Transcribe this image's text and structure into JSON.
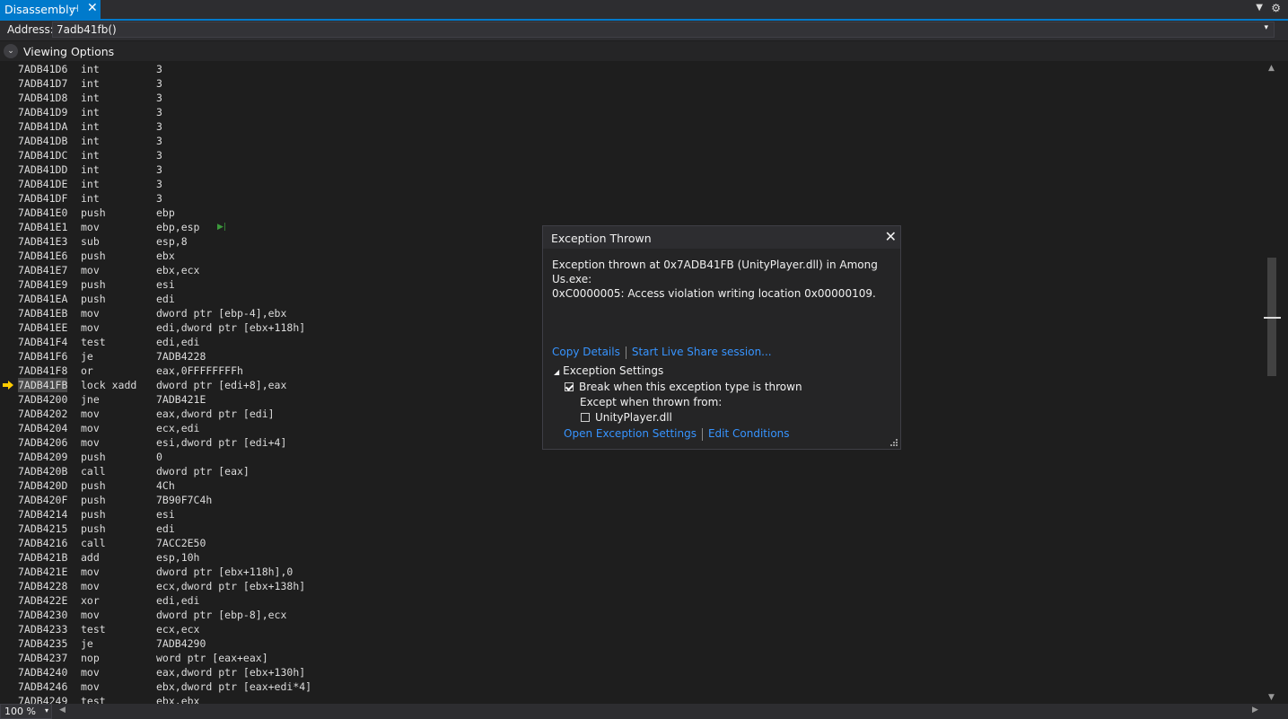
{
  "tab": {
    "title": "Disassembly",
    "pin": "⊣",
    "close": "✕"
  },
  "tabbar": {
    "menu": "▼",
    "gear": "⚙"
  },
  "address": {
    "label": "Address:",
    "value": "7adb41fb()",
    "drop": "▾"
  },
  "viewing_options": {
    "label": "Viewing Options",
    "toggle": "⌄"
  },
  "disassembly": [
    {
      "addr": "7ADB41D6",
      "mn": "int",
      "op": "3"
    },
    {
      "addr": "7ADB41D7",
      "mn": "int",
      "op": "3"
    },
    {
      "addr": "7ADB41D8",
      "mn": "int",
      "op": "3"
    },
    {
      "addr": "7ADB41D9",
      "mn": "int",
      "op": "3"
    },
    {
      "addr": "7ADB41DA",
      "mn": "int",
      "op": "3"
    },
    {
      "addr": "7ADB41DB",
      "mn": "int",
      "op": "3"
    },
    {
      "addr": "7ADB41DC",
      "mn": "int",
      "op": "3"
    },
    {
      "addr": "7ADB41DD",
      "mn": "int",
      "op": "3"
    },
    {
      "addr": "7ADB41DE",
      "mn": "int",
      "op": "3"
    },
    {
      "addr": "7ADB41DF",
      "mn": "int",
      "op": "3"
    },
    {
      "addr": "7ADB41E0",
      "mn": "push",
      "op": "ebp"
    },
    {
      "addr": "7ADB41E1",
      "mn": "mov",
      "op": "ebp,esp"
    },
    {
      "addr": "7ADB41E3",
      "mn": "sub",
      "op": "esp,8"
    },
    {
      "addr": "7ADB41E6",
      "mn": "push",
      "op": "ebx"
    },
    {
      "addr": "7ADB41E7",
      "mn": "mov",
      "op": "ebx,ecx"
    },
    {
      "addr": "7ADB41E9",
      "mn": "push",
      "op": "esi"
    },
    {
      "addr": "7ADB41EA",
      "mn": "push",
      "op": "edi"
    },
    {
      "addr": "7ADB41EB",
      "mn": "mov",
      "op": "dword ptr [ebp-4],ebx"
    },
    {
      "addr": "7ADB41EE",
      "mn": "mov",
      "op": "edi,dword ptr [ebx+118h]"
    },
    {
      "addr": "7ADB41F4",
      "mn": "test",
      "op": "edi,edi"
    },
    {
      "addr": "7ADB41F6",
      "mn": "je",
      "op": "7ADB4228"
    },
    {
      "addr": "7ADB41F8",
      "mn": "or",
      "op": "eax,0FFFFFFFFh"
    },
    {
      "addr": "7ADB41FB",
      "mn": "lock xadd",
      "op": "dword ptr [edi+8],eax"
    },
    {
      "addr": "7ADB4200",
      "mn": "jne",
      "op": "7ADB421E"
    },
    {
      "addr": "7ADB4202",
      "mn": "mov",
      "op": "eax,dword ptr [edi]"
    },
    {
      "addr": "7ADB4204",
      "mn": "mov",
      "op": "ecx,edi"
    },
    {
      "addr": "7ADB4206",
      "mn": "mov",
      "op": "esi,dword ptr [edi+4]"
    },
    {
      "addr": "7ADB4209",
      "mn": "push",
      "op": "0"
    },
    {
      "addr": "7ADB420B",
      "mn": "call",
      "op": "dword ptr [eax]"
    },
    {
      "addr": "7ADB420D",
      "mn": "push",
      "op": "4Ch"
    },
    {
      "addr": "7ADB420F",
      "mn": "push",
      "op": "7B90F7C4h"
    },
    {
      "addr": "7ADB4214",
      "mn": "push",
      "op": "esi"
    },
    {
      "addr": "7ADB4215",
      "mn": "push",
      "op": "edi"
    },
    {
      "addr": "7ADB4216",
      "mn": "call",
      "op": "7ACC2E50"
    },
    {
      "addr": "7ADB421B",
      "mn": "add",
      "op": "esp,10h"
    },
    {
      "addr": "7ADB421E",
      "mn": "mov",
      "op": "dword ptr [ebx+118h],0"
    },
    {
      "addr": "7ADB4228",
      "mn": "mov",
      "op": "ecx,dword ptr [ebx+138h]"
    },
    {
      "addr": "7ADB422E",
      "mn": "xor",
      "op": "edi,edi"
    },
    {
      "addr": "7ADB4230",
      "mn": "mov",
      "op": "dword ptr [ebp-8],ecx"
    },
    {
      "addr": "7ADB4233",
      "mn": "test",
      "op": "ecx,ecx"
    },
    {
      "addr": "7ADB4235",
      "mn": "je",
      "op": "7ADB4290"
    },
    {
      "addr": "7ADB4237",
      "mn": "nop",
      "op": "word ptr [eax+eax]"
    },
    {
      "addr": "7ADB4240",
      "mn": "mov",
      "op": "eax,dword ptr [ebx+130h]"
    },
    {
      "addr": "7ADB4246",
      "mn": "mov",
      "op": "ebx,dword ptr [eax+edi*4]"
    },
    {
      "addr": "7ADB4249",
      "mn": "test",
      "op": "ebx,ebx"
    }
  ],
  "current_row": 22,
  "run_to_click": "▶|",
  "exception": {
    "title": "Exception Thrown",
    "close": "✕",
    "message_line1": "Exception thrown at 0x7ADB41FB (UnityPlayer.dll) in Among Us.exe:",
    "message_line2": "0xC0000005: Access violation writing location 0x00000109.",
    "copy_details": "Copy Details",
    "live_share": "Start Live Share session...",
    "settings_header": "Exception Settings",
    "settings_toggle": "◢",
    "break_label": "Break when this exception type is thrown",
    "break_checked": true,
    "except_label": "Except when thrown from:",
    "module_label": "UnityPlayer.dll",
    "module_checked": false,
    "open_settings": "Open Exception Settings",
    "edit_conditions": "Edit Conditions"
  },
  "zoom": {
    "value": "100 %",
    "drop": "▾"
  },
  "scroll": {
    "up": "▲",
    "down": "▼",
    "left": "◀",
    "right": "▶"
  },
  "colors": {
    "accent": "#007acc",
    "link": "#3794ff",
    "ip_arrow": "#ffcc00"
  }
}
